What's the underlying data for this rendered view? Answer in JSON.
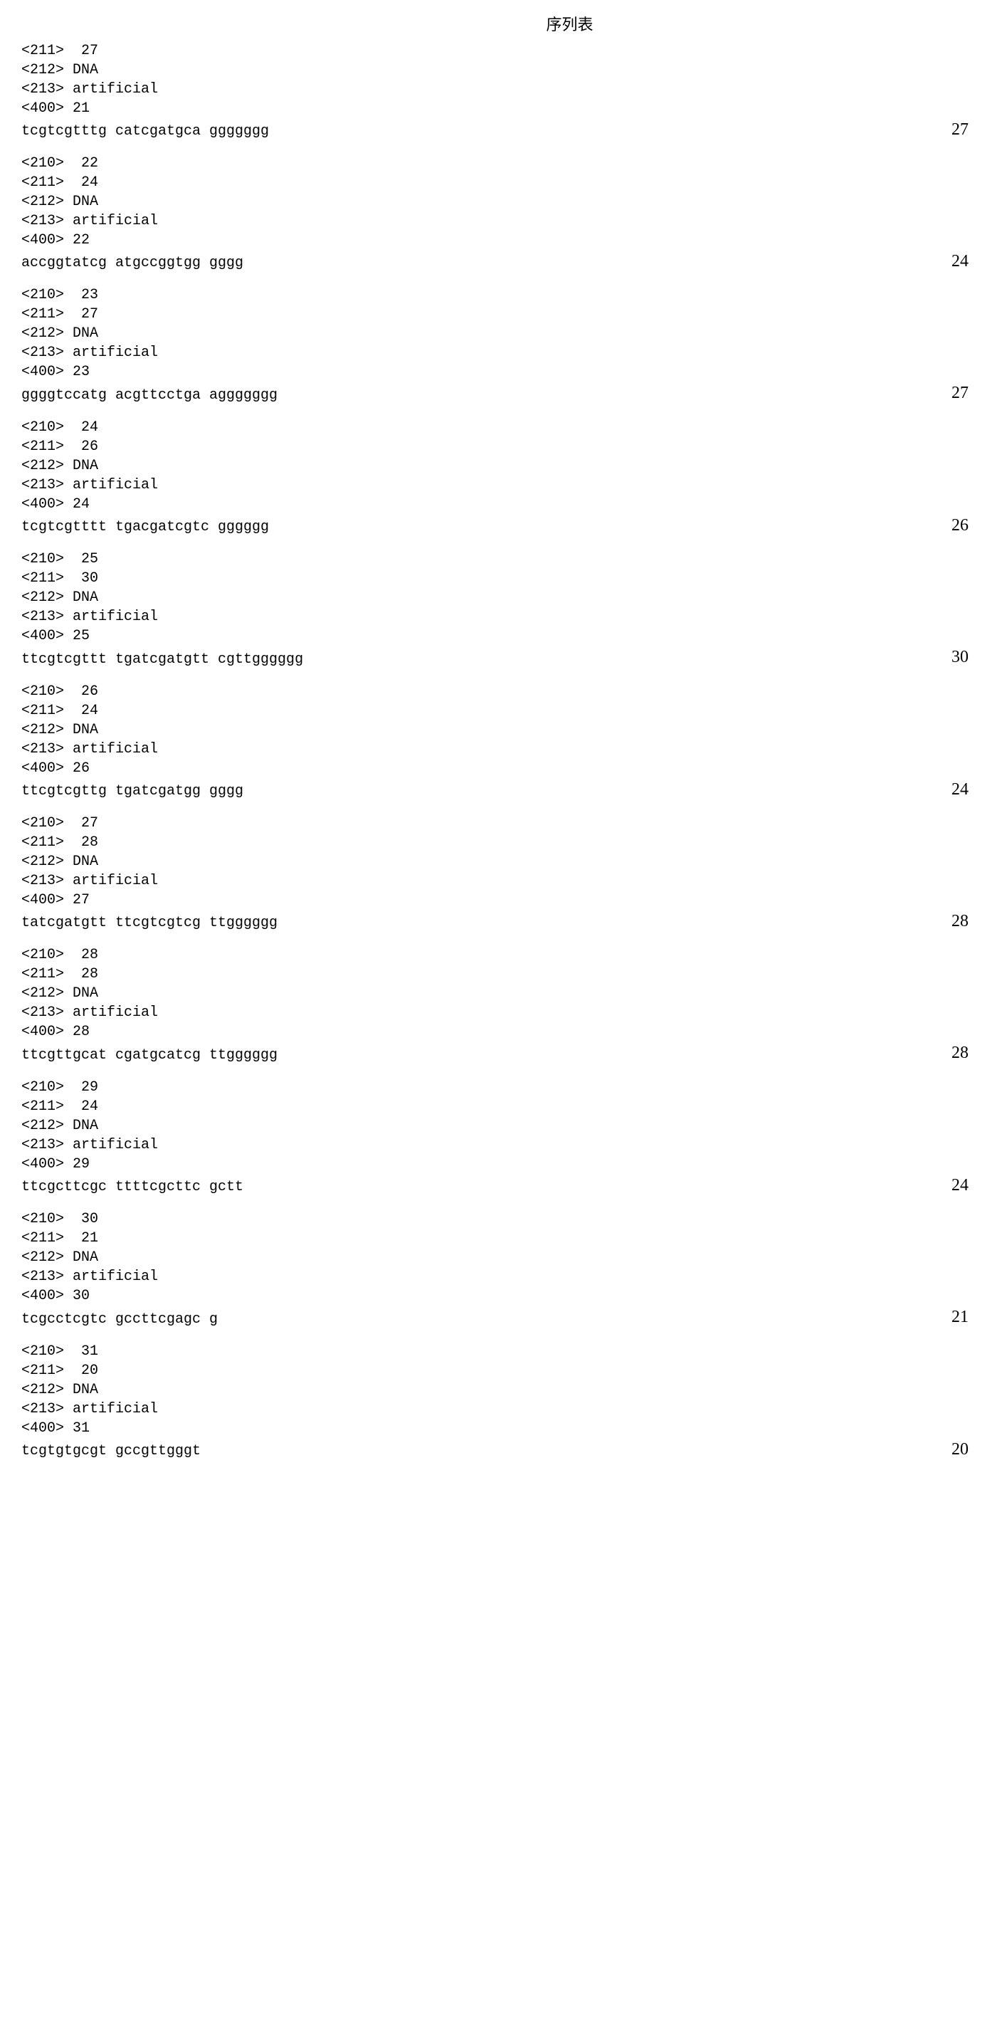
{
  "title": "序列表",
  "entries": [
    {
      "pre_lines": [
        "<211>  27",
        "<212> DNA",
        "<213> artificial",
        "<400> 21"
      ],
      "sequence": "tcgtcgtttg catcgatgca ggggggg",
      "length": "27"
    },
    {
      "pre_lines": [
        "<210>  22",
        "<211>  24",
        "<212> DNA",
        "<213> artificial",
        "<400> 22"
      ],
      "sequence": "accggtatcg atgccggtgg gggg",
      "length": "24"
    },
    {
      "pre_lines": [
        "<210>  23",
        "<211>  27",
        "<212> DNA",
        "<213> artificial",
        "<400> 23"
      ],
      "sequence": "ggggtccatg acgttcctga aggggggg",
      "length": "27"
    },
    {
      "pre_lines": [
        "<210>  24",
        "<211>  26",
        "<212> DNA",
        "<213> artificial",
        "<400> 24"
      ],
      "sequence": "tcgtcgtttt tgacgatcgtc gggggg",
      "length": "26"
    },
    {
      "pre_lines": [
        "<210>  25",
        "<211>  30",
        "<212> DNA",
        "<213> artificial",
        "<400> 25"
      ],
      "sequence": "ttcgtcgttt tgatcgatgtt cgttgggggg",
      "length": "30"
    },
    {
      "pre_lines": [
        "<210>  26",
        "<211>  24",
        "<212> DNA",
        "<213> artificial",
        "<400> 26"
      ],
      "sequence": "ttcgtcgttg tgatcgatgg gggg",
      "length": "24"
    },
    {
      "pre_lines": [
        "<210>  27",
        "<211>  28",
        "<212> DNA",
        "<213> artificial",
        "<400> 27"
      ],
      "sequence": "tatcgatgtt ttcgtcgtcg ttgggggg",
      "length": "28"
    },
    {
      "pre_lines": [
        "<210>  28",
        "<211>  28",
        "<212> DNA",
        "<213> artificial",
        "<400> 28"
      ],
      "sequence": "ttcgttgcat cgatgcatcg ttgggggg",
      "length": "28"
    },
    {
      "pre_lines": [
        "<210>  29",
        "<211>  24",
        "<212> DNA",
        "<213> artificial",
        "<400> 29"
      ],
      "sequence": "ttcgcttcgc ttttcgcttc gctt",
      "length": "24"
    },
    {
      "pre_lines": [
        "<210>  30",
        "<211>  21",
        "<212> DNA",
        "<213> artificial",
        "<400> 30"
      ],
      "sequence": "tcgcctcgtc gccttcgagc g",
      "length": "21"
    },
    {
      "pre_lines": [
        "<210>  31",
        "<211>  20",
        "<212> DNA",
        "<213> artificial",
        "<400> 31"
      ],
      "sequence": "tcgtgtgcgt gccgttgggt",
      "length": "20"
    }
  ]
}
